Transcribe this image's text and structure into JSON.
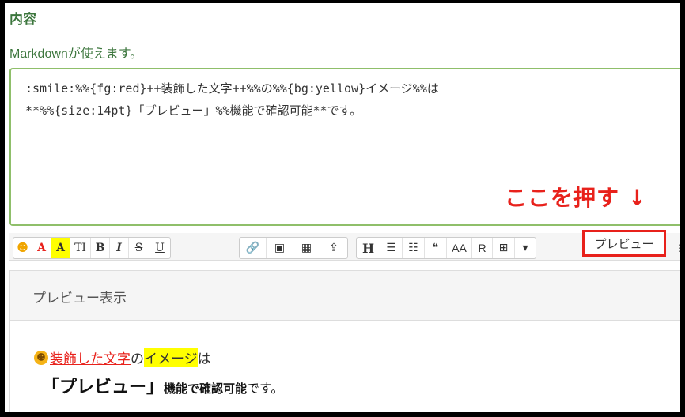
{
  "section": {
    "title": "内容",
    "hint": "Markdownが使えます。"
  },
  "editor": {
    "line1": ":smile:%%{fg:red}++装飾した文字++%%の%%{bg:yellow}イメージ%%は",
    "line2": "**%%{size:14pt}「プレビュー」%%機能で確認可能**です。"
  },
  "callout": "ここを押す ↓",
  "toolbar": {
    "emoji": "☻",
    "text_color": "A",
    "bg_color": "A",
    "font_size": "TI",
    "bold": "B",
    "italic": "I",
    "strike": "S",
    "underline": "U",
    "link": "🔗",
    "image": "▣",
    "video": "▦",
    "upload": "⇪",
    "heading": "H",
    "ul": "☰",
    "ol": "☷",
    "quote": "❝",
    "aa": "AA",
    "r": "R",
    "table": "⊞",
    "dropdown": "▾",
    "preview": "プレビュー",
    "more": "⋮"
  },
  "preview": {
    "header": "プレビュー表示",
    "emoji": "☻",
    "seg_red": "装飾した文字",
    "seg_no": "の",
    "seg_yellow": "イメージ",
    "seg_ha": "は",
    "big": "「プレビュー」",
    "bold_rest": "機能で確認可能",
    "tail": "です。"
  },
  "colors": {
    "accent_red": "#e8211b",
    "green_label": "#3c763d",
    "border_green": "#8fbf6a",
    "highlight": "#ffff00"
  }
}
